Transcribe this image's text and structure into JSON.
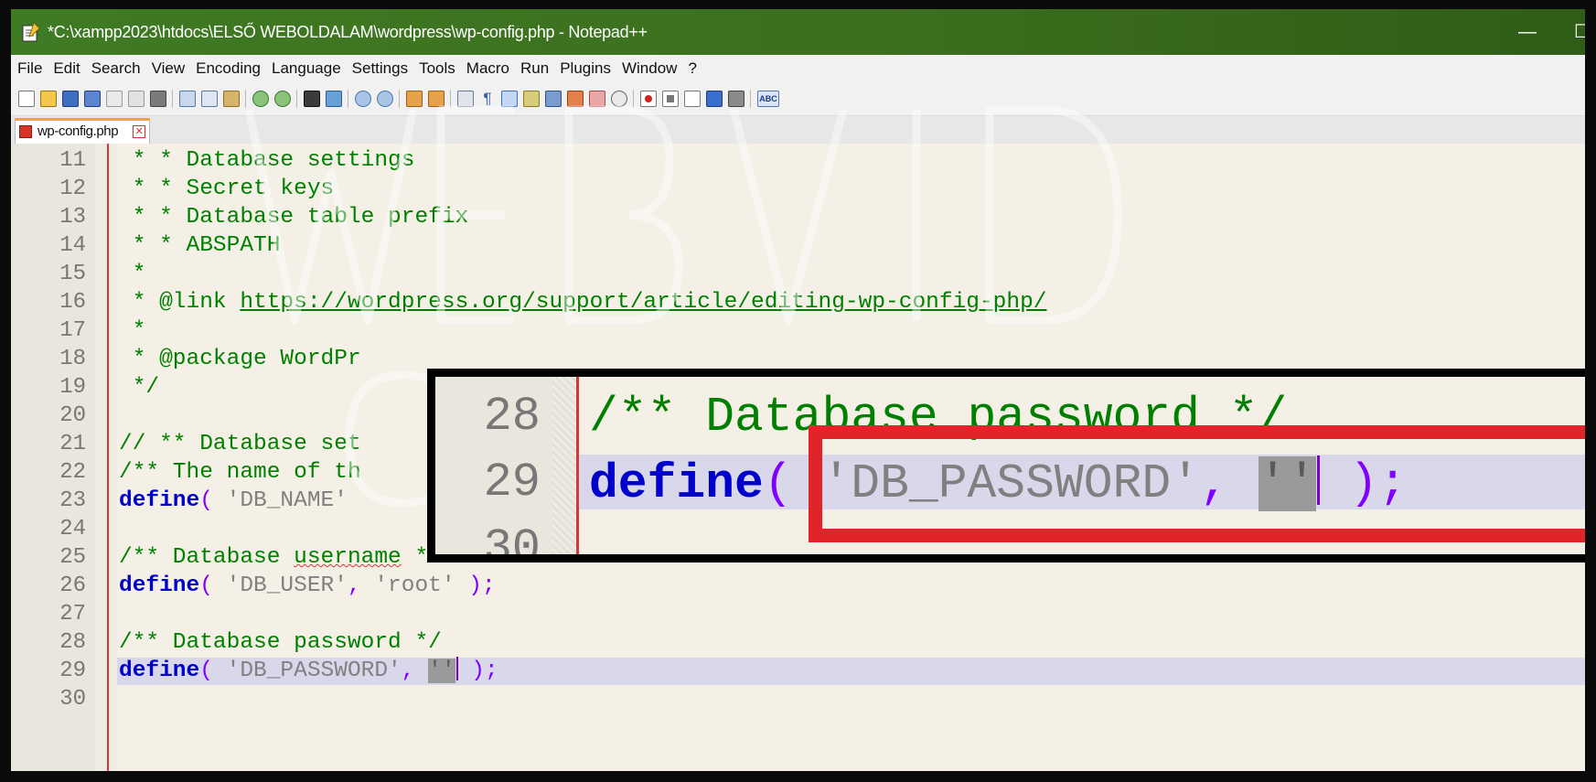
{
  "window": {
    "title": "*C:\\xampp2023\\htdocs\\ELSŐ WEBOLDALAM\\wordpress\\wp-config.php - Notepad++",
    "minimize_glyph": "—",
    "maximize_glyph": "☐"
  },
  "menu": [
    "File",
    "Edit",
    "Search",
    "View",
    "Encoding",
    "Language",
    "Settings",
    "Tools",
    "Macro",
    "Run",
    "Plugins",
    "Window",
    "?"
  ],
  "toolbar": {
    "icons": [
      "new-file-icon",
      "open-file-icon",
      "save-icon",
      "save-all-icon",
      "close-icon",
      "close-all-icon",
      "print-icon",
      "cut-icon",
      "copy-icon",
      "paste-icon",
      "undo-icon",
      "redo-icon",
      "find-icon",
      "replace-icon",
      "zoom-in-icon",
      "zoom-out-icon",
      "sync-vertical-icon",
      "sync-horizontal-icon",
      "word-wrap-icon",
      "show-all-chars-icon",
      "indent-guide-icon",
      "user-lang-icon",
      "doc-map-icon",
      "function-list-icon",
      "folder-workspace-icon",
      "monitoring-icon",
      "record-macro-icon",
      "stop-record-icon",
      "play-macro-icon",
      "run-macro-multiple-icon",
      "save-macro-icon",
      "spell-check-icon"
    ],
    "spell_check_label": "ABC"
  },
  "tab": {
    "label": "wp-config.php",
    "close_glyph": "✕"
  },
  "editor": {
    "line_numbers": [
      "11",
      "12",
      "13",
      "14",
      "15",
      "16",
      "17",
      "18",
      "19",
      "20",
      "21",
      "22",
      "23",
      "24",
      "25",
      "26",
      "27",
      "28",
      "29",
      "30"
    ],
    "lines": {
      "l11": " * * Database settings",
      "l12": " * * Secret keys",
      "l13": " * * Database table prefix",
      "l14": " * * ABSPATH",
      "l15": " *",
      "l16_prefix": " * @link ",
      "l16_link": "https://wordpress.org/support/article/editing-wp-config-php/",
      "l17": " *",
      "l18": " * @package WordPr",
      "l19": " */",
      "l21": "// ** Database set",
      "l22": "/** The name of th",
      "l23_kw": "define",
      "l23_open": "( ",
      "l23_str": "'DB_NAME'",
      "l25_a": "/** Database ",
      "l25_b": "username",
      "l25_c": " */",
      "l26_kw": "define",
      "l26_open": "( ",
      "l26_str1": "'DB_USER'",
      "l26_comma": ", ",
      "l26_str2": "'root'",
      "l26_close": " );",
      "l28": "/** Database password */",
      "l29_kw": "define",
      "l29_open": "( ",
      "l29_str1": "'DB_PASSWORD'",
      "l29_comma": ", ",
      "l29_str2": "''",
      "l29_close": " );"
    }
  },
  "zoom": {
    "line_numbers": [
      "28",
      "29",
      "30"
    ],
    "l28": "/** Database password */",
    "l29_kw": "define",
    "l29_open": "( ",
    "l29_str1": "'DB_PASSWORD'",
    "l29_comma": ", ",
    "l29_str2": "''",
    "l29_close": " );"
  },
  "colors": {
    "titlebar": "#3f7a24",
    "highlight_box": "#e0242a",
    "keyword": "#0000cc",
    "comment": "#008000",
    "operator": "#8000ff",
    "string": "#808080"
  }
}
